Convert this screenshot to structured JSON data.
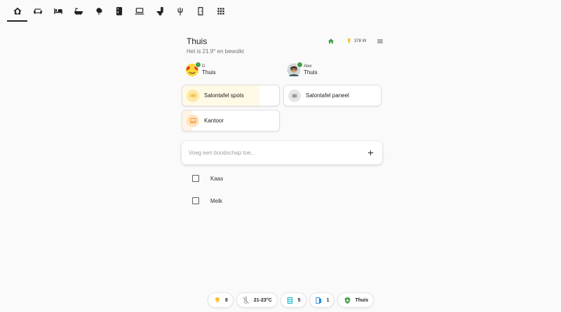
{
  "tabs": [
    {
      "icon": "home-leaf-icon",
      "active": true
    },
    {
      "icon": "sofa-icon",
      "active": false
    },
    {
      "icon": "bed-icon",
      "active": false
    },
    {
      "icon": "bathtub-icon",
      "active": false
    },
    {
      "icon": "tree-icon",
      "active": false
    },
    {
      "icon": "fridge-icon",
      "active": false
    },
    {
      "icon": "laptop-icon",
      "active": false
    },
    {
      "icon": "toilet-icon",
      "active": false
    },
    {
      "icon": "tuning-fork-icon",
      "active": false
    },
    {
      "icon": "door-icon",
      "active": false
    },
    {
      "icon": "grid-icon",
      "active": false
    }
  ],
  "header": {
    "title": "Thuis",
    "subtitle": "Het is 21.9° en bewolkt",
    "power": "378 W"
  },
  "persons": [
    {
      "name": "D",
      "state": "Thuis"
    },
    {
      "name": "Alex",
      "state": "Thuis"
    }
  ],
  "tiles": [
    {
      "label": "Salontafel spots",
      "state": "on",
      "brightness": 0.8
    },
    {
      "label": "Salontafel paneel",
      "state": "off"
    },
    {
      "label": "Kantoor",
      "state": "on",
      "brightness": 0.1
    }
  ],
  "shopping": {
    "placeholder": "Voeg een boodschap toe...",
    "items": [
      {
        "label": "Kaas",
        "checked": false
      },
      {
        "label": "Melk",
        "checked": false
      }
    ]
  },
  "chips": [
    {
      "icon": "lightbulb-icon",
      "value": "8"
    },
    {
      "icon": "thermostat-off-icon",
      "value": "21-23°C"
    },
    {
      "icon": "radiator-icon",
      "value": "5"
    },
    {
      "icon": "door-open-icon",
      "value": "1"
    },
    {
      "icon": "shield-home-icon",
      "value": "Thuis"
    }
  ],
  "colors": {
    "accent": "#212121",
    "home_green": "#43a047",
    "power_yellow": "#fdd835",
    "light_on": "#fdd835",
    "light_orange": "#ff9800",
    "radiator_teal": "#00acc1",
    "door_blue": "#1e88e5"
  }
}
